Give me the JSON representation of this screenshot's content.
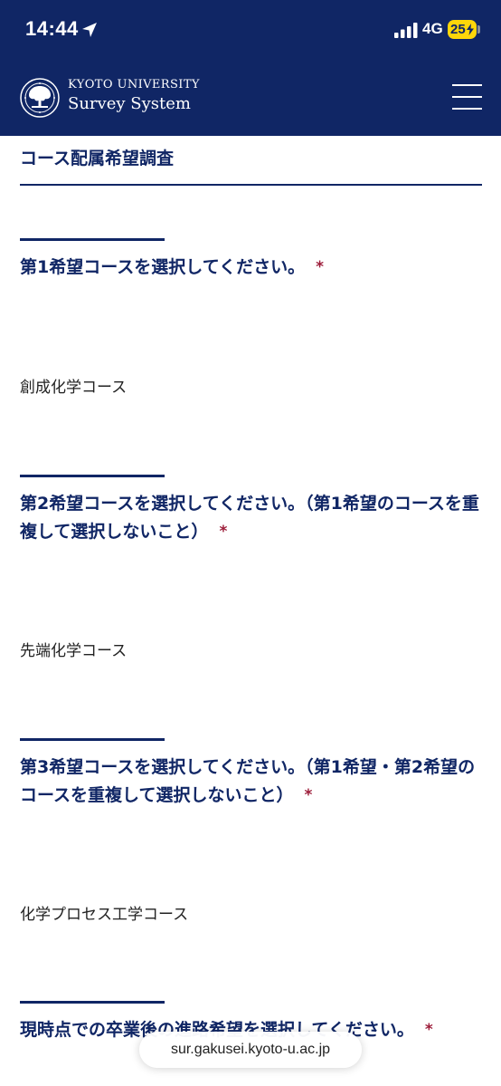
{
  "status_bar": {
    "time": "14:44",
    "network": "4G",
    "battery": "25",
    "icons": [
      "location-arrow-icon",
      "signal-bars-icon",
      "battery-charging-icon"
    ]
  },
  "header": {
    "logo_line1": "KYOTO UNIVERSITY",
    "logo_line2": "Survey System",
    "menu_icon": "hamburger-icon",
    "background_color": "#102665"
  },
  "page_title": "コース配属希望調査",
  "questions": [
    {
      "label": "第1希望コースを選択してください。",
      "required_mark": "*",
      "answer": "創成化学コース"
    },
    {
      "label": "第2希望コースを選択してください。（第1希望のコースを重複して選択しないこと）",
      "required_mark": "*",
      "answer": "先端化学コース"
    },
    {
      "label": "第3希望コースを選択してください。（第1希望・第2希望のコースを重複して選択しないこと）",
      "required_mark": "*",
      "answer": "化学プロセス工学コース"
    },
    {
      "label": "現時点での卒業後の進路希望を選択してください。",
      "required_mark": "*",
      "answer": ""
    }
  ],
  "url_bar": {
    "url": "sur.gakusei.kyoto-u.ac.jp"
  },
  "colors": {
    "accent": "#102665",
    "required": "#9d1d3a",
    "battery": "#ffd60a"
  }
}
